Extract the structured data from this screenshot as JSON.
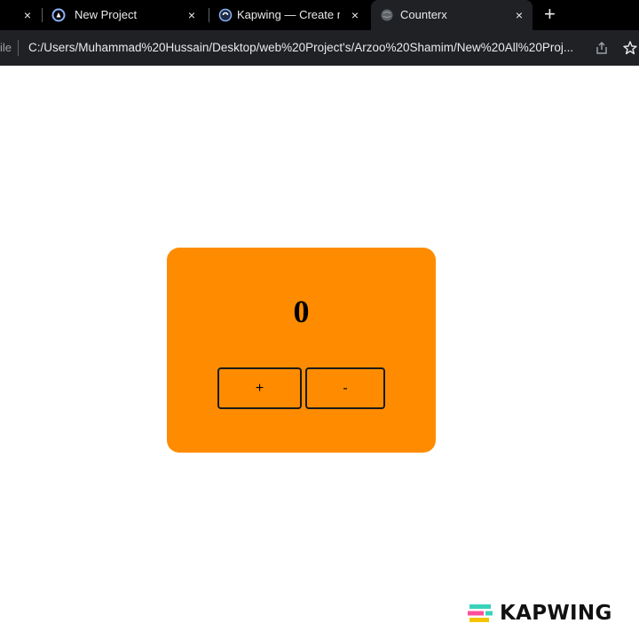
{
  "browser": {
    "tabs": [
      {
        "title": "",
        "icon": "page-icon",
        "active": false
      },
      {
        "title": "New Project",
        "icon": "project-icon",
        "active": false
      },
      {
        "title": "Kapwing — Create mo",
        "icon": "kapwing-icon",
        "active": false
      },
      {
        "title": "Counterx",
        "icon": "globe-icon",
        "active": true
      }
    ],
    "new_tab_label": "+",
    "close_label": "×"
  },
  "addressbar": {
    "scheme_label": "ile",
    "url": "C:/Users/Muhammad%20Hussain/Desktop/web%20Project's/Arzoo%20Shamim/New%20All%20Proj..."
  },
  "counter": {
    "value": "0",
    "increment_label": "+",
    "decrement_label": "-"
  },
  "watermark": {
    "text": "KAPWING"
  },
  "colors": {
    "card": "#ff8c00",
    "tabstrip": "#000000",
    "toolbar": "#202124",
    "watermark_logo": [
      "#3ad2b9",
      "#ff4f9a",
      "#f5c400"
    ]
  }
}
